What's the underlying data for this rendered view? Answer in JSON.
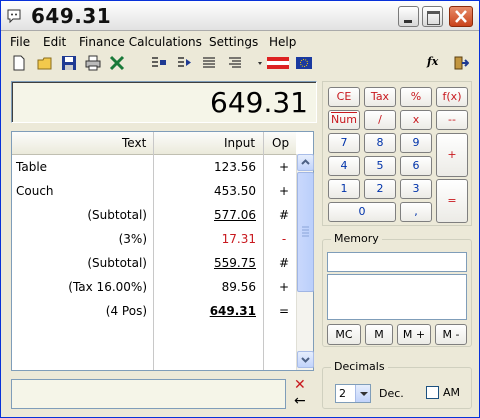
{
  "window": {
    "title": "649.31"
  },
  "menu": [
    "File",
    "Edit",
    "Finance Calculations",
    "Settings",
    "Help"
  ],
  "toolbar": {
    "icons": [
      "new-icon",
      "open-icon",
      "save-icon",
      "print-icon",
      "excel-export-icon",
      "indent-left-icon",
      "indent-right-icon",
      "align-left-icon",
      "align-right-icon",
      "flag-dropdown-icon",
      "eu-flag-icon",
      "function-icon",
      "exit-icon"
    ],
    "fx_label": "fx"
  },
  "display": {
    "value": "649.31"
  },
  "tape": {
    "headers": {
      "text": "Text",
      "input": "Input",
      "op": "Op"
    },
    "rows": [
      {
        "text": "Table",
        "input": "123.56",
        "op": "+"
      },
      {
        "text": "Couch",
        "input": "453.50",
        "op": "+"
      },
      {
        "text": "(Subtotal)",
        "input": "577.06",
        "op": "#"
      },
      {
        "text": "(3%)",
        "input": "17.31",
        "op": "-"
      },
      {
        "text": "(Subtotal)",
        "input": "559.75",
        "op": "#"
      },
      {
        "text": "(Tax 16.00%)",
        "input": "89.56",
        "op": "+"
      },
      {
        "text": "(4 Pos)",
        "input": "649.31",
        "op": "="
      }
    ]
  },
  "tape_actions": {
    "clear": "✕",
    "back": "←"
  },
  "keypad": {
    "ce": "CE",
    "tax": "Tax",
    "percent": "%",
    "fx": "f(x)",
    "num": "Num",
    "div": "/",
    "mul": "x",
    "minus": "--",
    "k7": "7",
    "k8": "8",
    "k9": "9",
    "plus": "+",
    "k4": "4",
    "k5": "5",
    "k6": "6",
    "k1": "1",
    "k2": "2",
    "k3": "3",
    "equals": "=",
    "k0": "0",
    "comma": ","
  },
  "memory": {
    "title": "Memory",
    "buttons": {
      "mc": "MC",
      "m": "M",
      "mplus": "M +",
      "mminus": "M -"
    }
  },
  "decimals": {
    "title": "Decimals",
    "selected": "2",
    "dec_label": "Dec.",
    "am_label": "AM",
    "am_checked": false
  },
  "colors": {
    "accent_red": "#c8181e",
    "key_blue": "#0033aa",
    "display_bg": "#f5f5e8"
  }
}
